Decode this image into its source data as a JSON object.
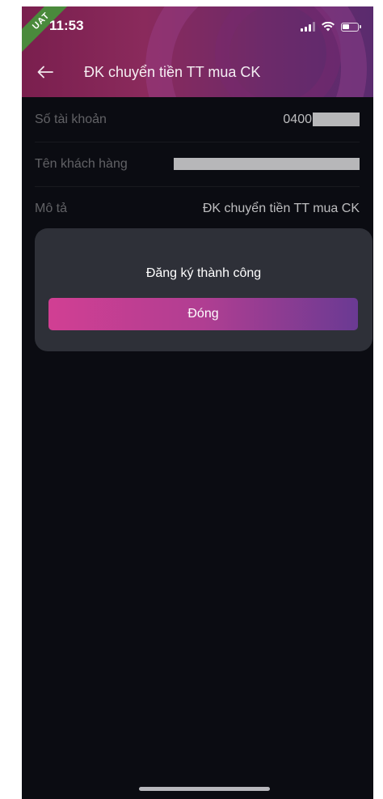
{
  "status_bar": {
    "time": "11:53",
    "env_badge": "UAT",
    "icons": [
      "signal-icon",
      "wifi-icon",
      "battery-icon"
    ]
  },
  "header": {
    "back_icon": "arrow-left-icon",
    "title": "ĐK chuyển tiền TT mua CK"
  },
  "details": {
    "rows": [
      {
        "label": "Số tài khoản",
        "value_visible": "0400",
        "masked": true
      },
      {
        "label": "Tên khách hàng",
        "value_visible": "",
        "masked": true
      },
      {
        "label": "Mô tả",
        "value_visible": "ĐK chuyển tiền TT mua CK",
        "masked": false
      }
    ]
  },
  "dialog": {
    "message": "Đăng ký thành công",
    "close_label": "Đóng"
  },
  "colors": {
    "background": "#0b0c12",
    "dialog_bg": "#2e3038",
    "button_gradient_start": "#d13f93",
    "button_gradient_end": "#6a3a93",
    "header_gradient_start": "#7a1f4e",
    "header_gradient_end": "#5a2b6e",
    "uat_ribbon": "#4a8a3c"
  }
}
